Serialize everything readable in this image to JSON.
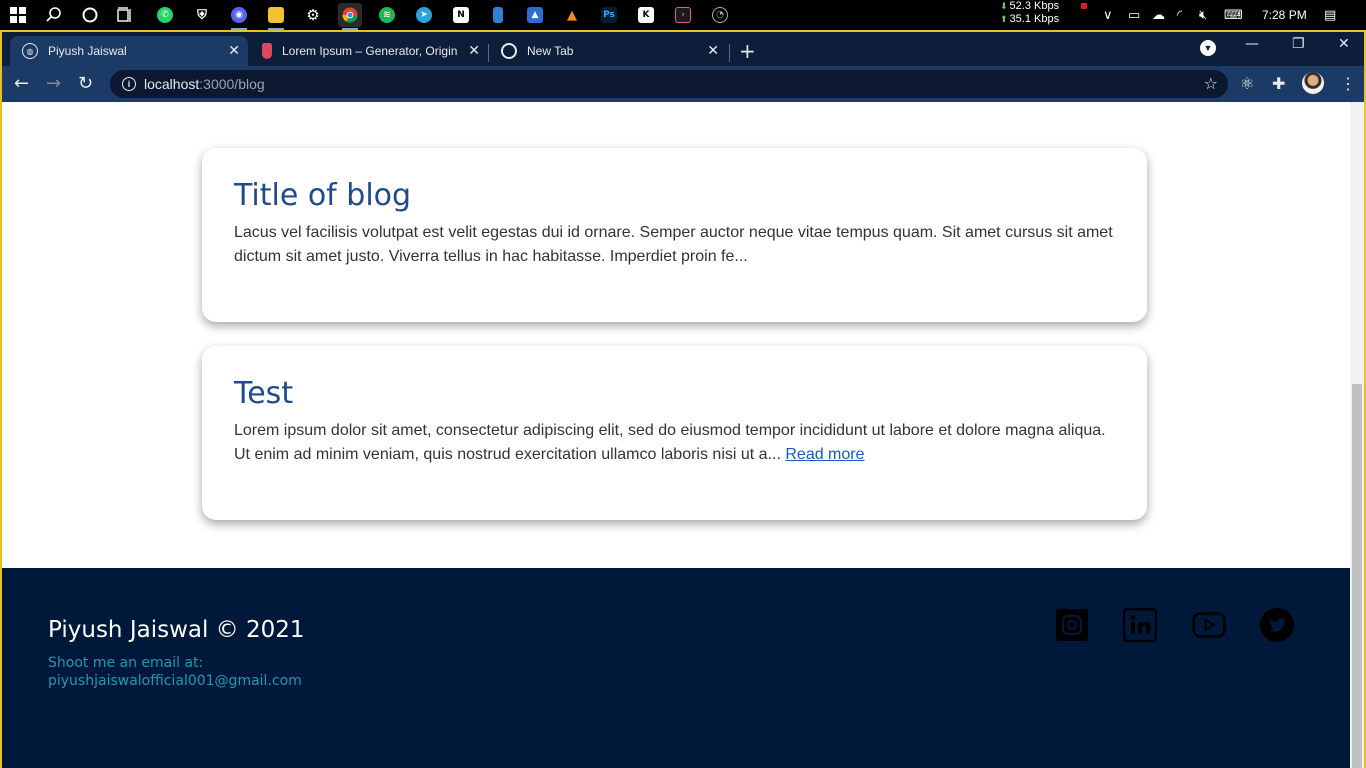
{
  "taskbar": {
    "net_down": "52.3 Kbps",
    "net_up": "35.1 Kbps",
    "time": "7:28 PM",
    "apps": [
      "start-icon",
      "search-icon",
      "cortana-icon",
      "task-view-icon",
      "whatsapp-icon",
      "security-icon",
      "discord-icon",
      "file-explorer-icon",
      "settings-icon",
      "chrome-icon",
      "spotify-icon",
      "telegram-icon",
      "notion-icon",
      "document-icon",
      "photos-icon",
      "vlc-icon",
      "photoshop-icon",
      "ide-icon",
      "terminal-icon",
      "misc-icon"
    ]
  },
  "browser": {
    "tabs": [
      {
        "title": "Piyush Jaiswal",
        "active": true
      },
      {
        "title": "Lorem Ipsum – Generator, Origin",
        "active": false
      },
      {
        "title": "New Tab",
        "active": false
      }
    ],
    "url_host": "localhost",
    "url_path": ":3000/blog"
  },
  "blog": {
    "posts": [
      {
        "title": "Title of blog",
        "excerpt": "Lacus vel facilisis volutpat est velit egestas dui id ornare. Semper auctor neque vitae tempus quam. Sit amet cursus sit amet dictum sit amet justo. Viverra tellus in hac habitasse. Imperdiet proin fe..."
      },
      {
        "title": "Test",
        "excerpt": "Lorem ipsum dolor sit amet, consectetur adipiscing elit, sed do eiusmod tempor incididunt ut labore et dolore magna aliqua. Ut enim ad minim veniam, quis nostrud exercitation ullamco laboris nisi ut a...",
        "read_more": "Read more"
      }
    ]
  },
  "footer": {
    "name": "Piyush Jaiswal © 2021",
    "email_label": "Shoot me an email at:",
    "email": "piyushjaiswalofficial001@gmail.com",
    "social": [
      "instagram-icon",
      "linkedin-icon",
      "youtube-icon",
      "twitter-icon"
    ]
  },
  "colors": {
    "footer_bg": "#001839",
    "title_blue": "#1f4a8c",
    "email_teal": "#1b9bb0",
    "frame_border": "#e3c325"
  }
}
